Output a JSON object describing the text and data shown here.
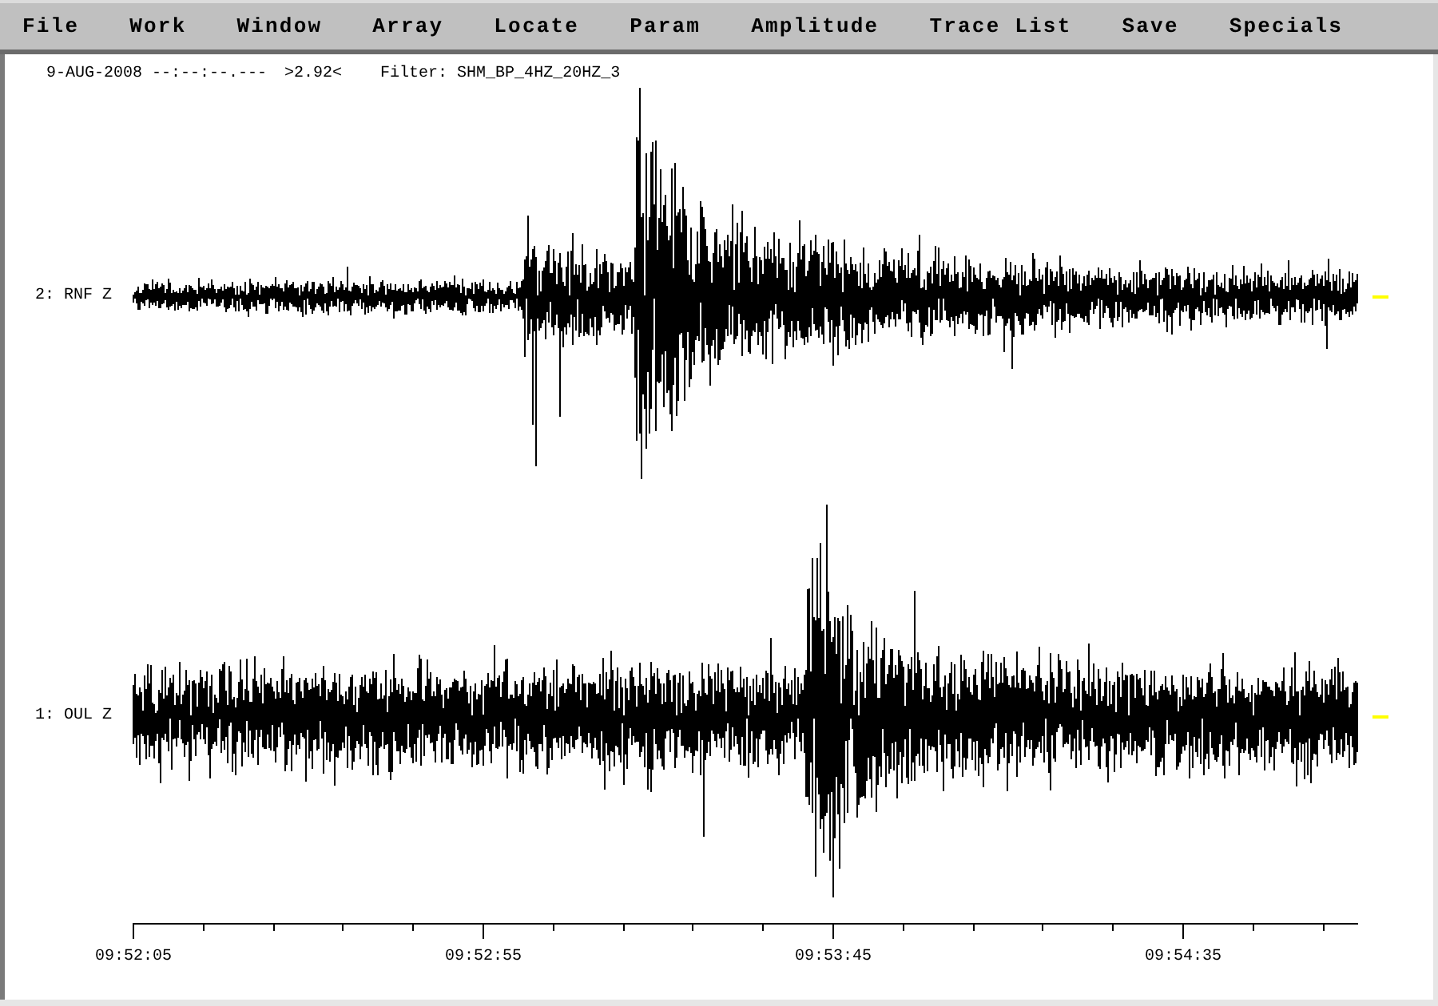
{
  "menu_bar": {
    "items": [
      "File",
      "Work",
      "Window",
      "Array",
      "Locate",
      "Param",
      "Amplitude",
      "Trace List",
      "Save",
      "Specials"
    ]
  },
  "header": {
    "timestamp": "9-AUG-2008 --:--:--.---",
    "reading": ">2.92<",
    "filter": "Filter: SHM_BP_4HZ_20HZ_3"
  },
  "traces": [
    {
      "label": "2: RNF Z"
    },
    {
      "label": "1: OUL Z"
    }
  ],
  "time_axis": {
    "tick_labels": [
      "09:52:05",
      "09:52:55",
      "09:53:45",
      "09:54:35"
    ]
  }
}
